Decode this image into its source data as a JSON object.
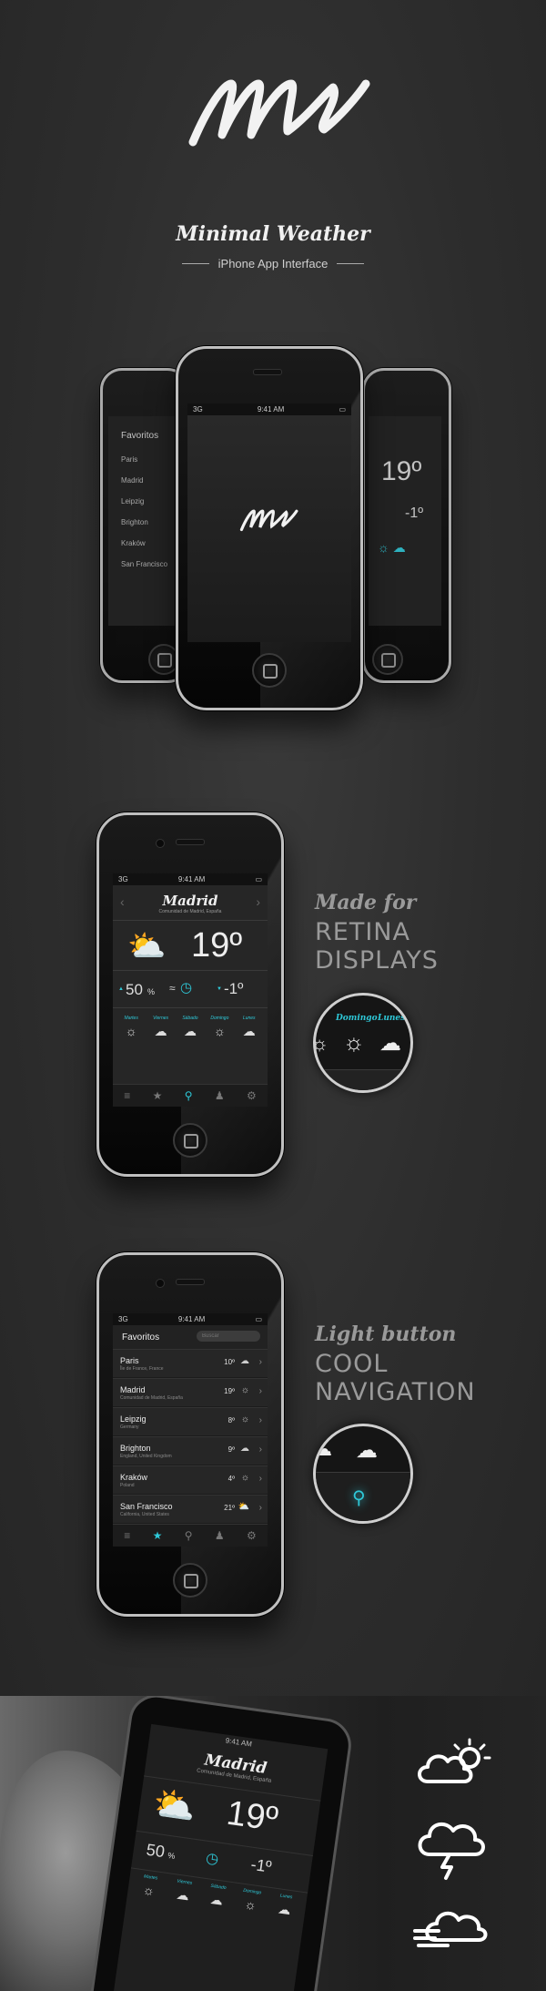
{
  "brand": {
    "logo_text": "MW",
    "title": "Minimal Weather",
    "subtitle": "iPhone App Interface"
  },
  "status": {
    "carrier": "3G",
    "time": "9:41 AM"
  },
  "weather": {
    "city": "Madrid",
    "region": "Comunidad de Madrid, España",
    "temp": "19º",
    "humidity": "50",
    "humidity_unit": "%",
    "min": "-1º",
    "days": [
      {
        "label": "Martes",
        "icon": "sun"
      },
      {
        "label": "Viernes",
        "icon": "rain-cloud"
      },
      {
        "label": "Sábado",
        "icon": "rain-cloud"
      },
      {
        "label": "Domingo",
        "icon": "sun"
      },
      {
        "label": "Lunes",
        "icon": "wind-cloud"
      }
    ]
  },
  "favorites": {
    "title": "Favoritos",
    "search_placeholder": "Buscar",
    "cities": [
      {
        "name": "Paris",
        "region": "Île de France, France",
        "temp": "10º",
        "icon": "storm-cloud"
      },
      {
        "name": "Madrid",
        "region": "Comunidad de Madrid, España",
        "temp": "19º",
        "icon": "sun"
      },
      {
        "name": "Leipzig",
        "region": "Germany",
        "temp": "8º",
        "icon": "sun"
      },
      {
        "name": "Brighton",
        "region": "England, United Kingdom",
        "temp": "9º",
        "icon": "wind-cloud"
      },
      {
        "name": "Kraków",
        "region": "Poland",
        "temp": "4º",
        "icon": "sun"
      },
      {
        "name": "San Francisco",
        "region": "California, United States",
        "temp": "21º",
        "icon": "partly-cloudy"
      }
    ]
  },
  "side_phone": {
    "temp": "19º",
    "min": "-1º"
  },
  "features": [
    {
      "title": "Made for",
      "line1": "RETINA",
      "line2": "DISPLAYS",
      "zoom_labels": [
        "Domingo",
        "Lunes"
      ]
    },
    {
      "title": "Light button",
      "line1": "COOL",
      "line2": "NAVIGATION"
    }
  ],
  "photo": {
    "city": "Madrid",
    "region": "Comunidad de Madrid, España",
    "temp": "19º",
    "humidity": "50",
    "humidity_unit": "%",
    "min": "-1º",
    "days": [
      "Martes",
      "Viernes",
      "Sábado",
      "Domingo",
      "Lunes"
    ]
  },
  "colors": {
    "accent": "#2ec8d8",
    "background": "#2b2b2b"
  }
}
